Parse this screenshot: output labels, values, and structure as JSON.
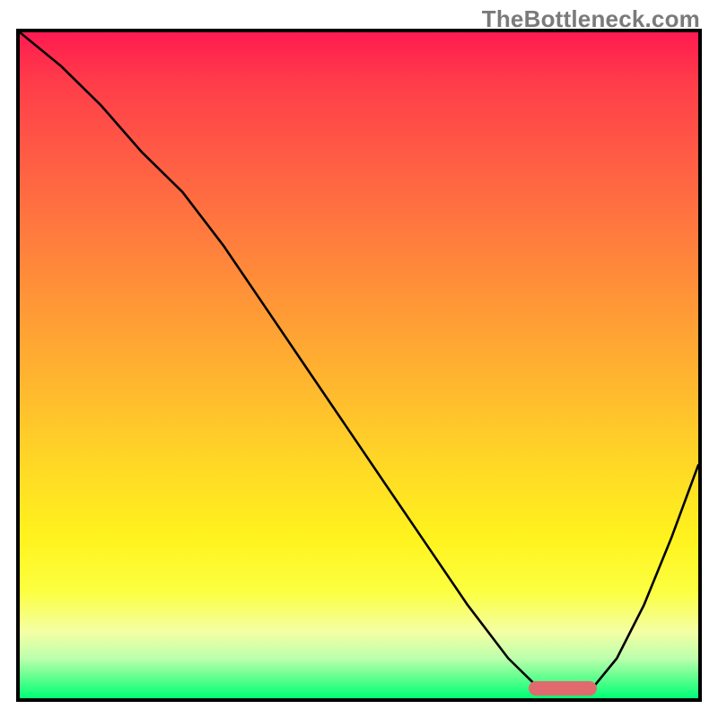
{
  "watermark": "TheBottleneck.com",
  "colors": {
    "gradient_top": "#ff1a50",
    "gradient_mid1": "#ff7a3e",
    "gradient_mid2": "#ffdb25",
    "gradient_yellow": "#fff31e",
    "gradient_bottom": "#00ff76",
    "curve": "#000000",
    "frame": "#000000",
    "optimal_pill": "#e06a6e"
  },
  "chart_data": {
    "type": "line",
    "title": "",
    "xlabel": "",
    "ylabel": "",
    "xlim": [
      0,
      100
    ],
    "ylim": [
      0,
      100
    ],
    "grid": false,
    "note": "y≈0 (green) = no bottleneck; y≈100 (red) = severe bottleneck. x is a normalized hardware-capability axis (left→right = weaker→stronger component). Values are read off pixel positions; no ticks are shown.",
    "series": [
      {
        "name": "bottleneck-curve",
        "x": [
          0,
          6,
          12,
          18,
          24,
          30,
          36,
          42,
          48,
          54,
          60,
          66,
          72,
          76,
          80,
          84,
          88,
          92,
          96,
          100
        ],
        "y": [
          100,
          95,
          89,
          82,
          76,
          68,
          59,
          50,
          41,
          32,
          23,
          14,
          6,
          2,
          1,
          1,
          6,
          14,
          24,
          35
        ]
      }
    ],
    "annotations": [
      {
        "name": "optimal-range-pill",
        "x_start": 75,
        "x_end": 85,
        "y": 1.5,
        "note": "small pink bar marking the low-bottleneck region"
      }
    ]
  }
}
